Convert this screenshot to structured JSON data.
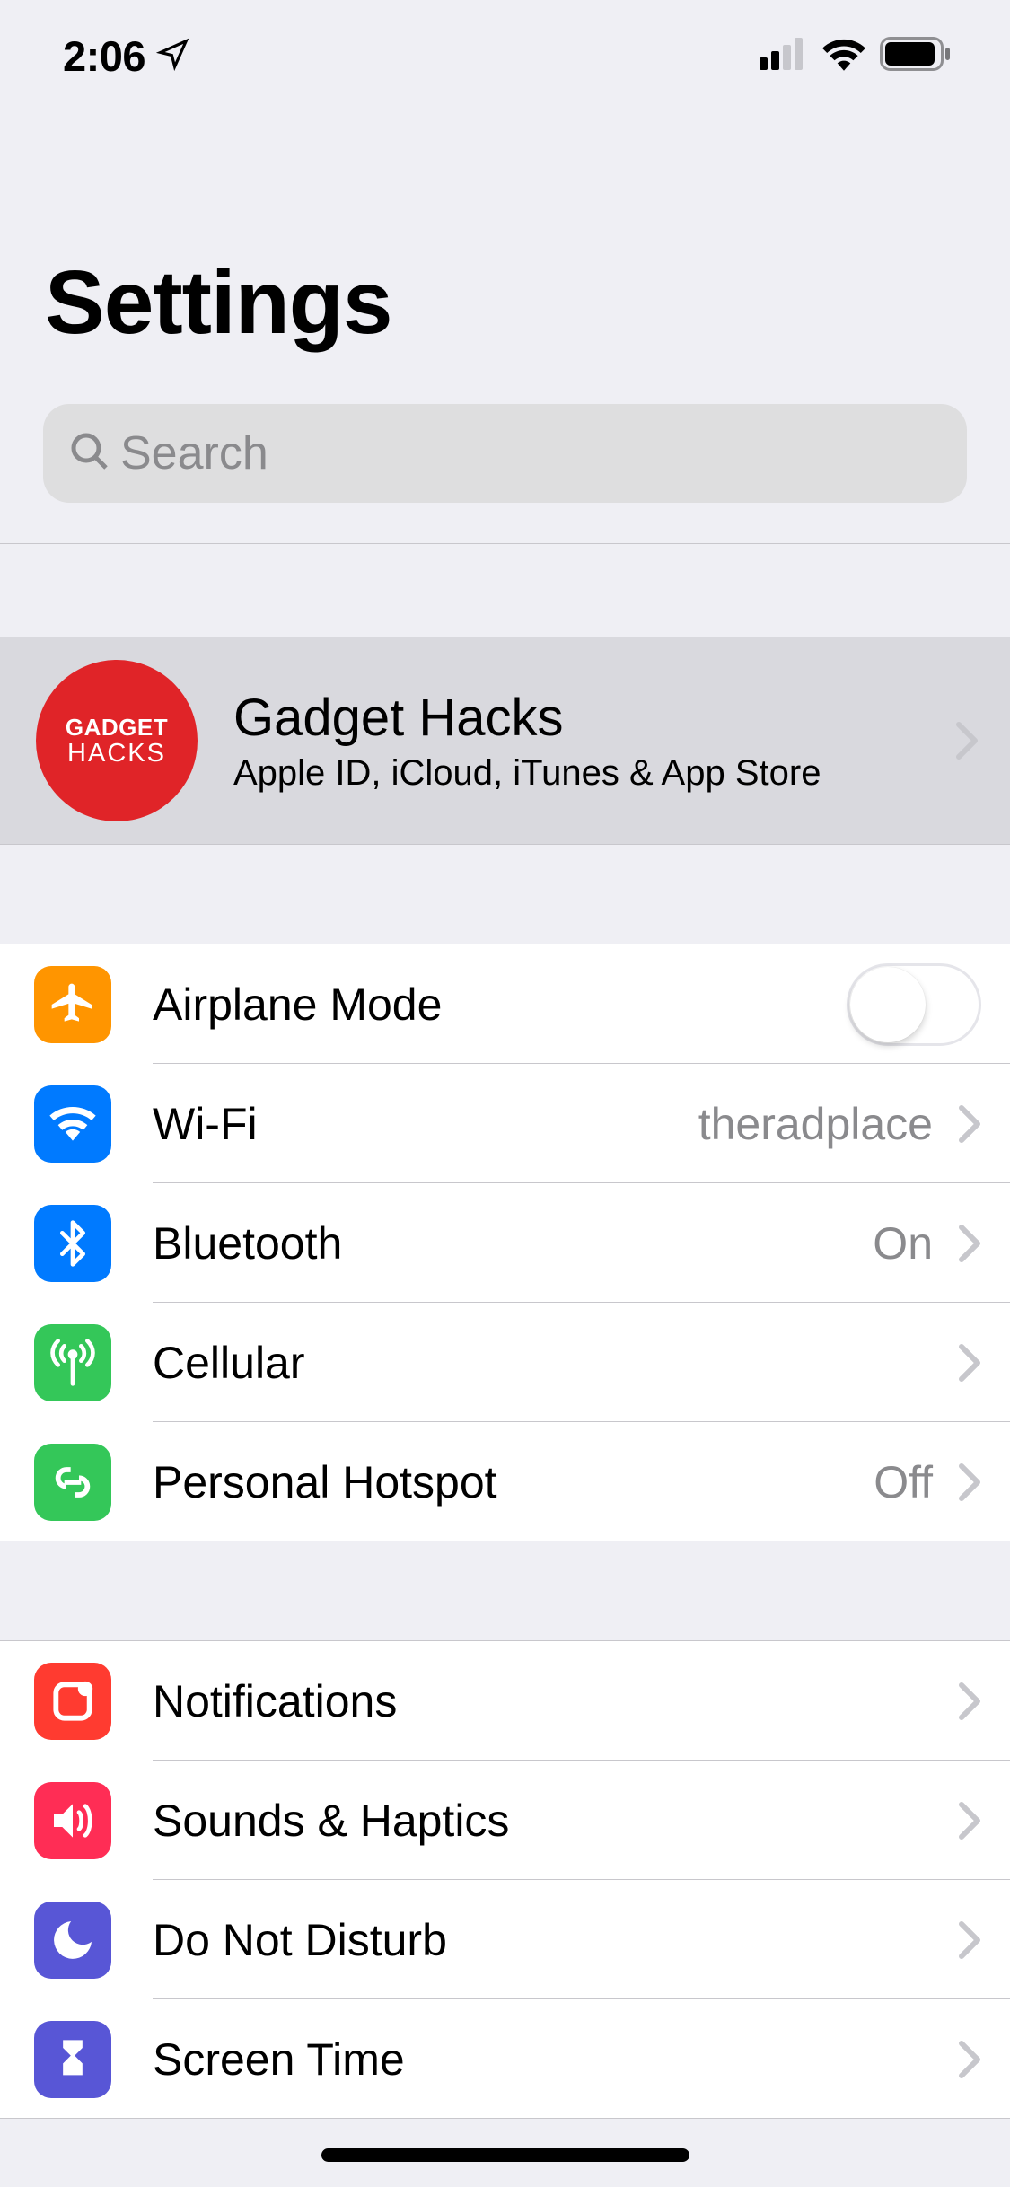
{
  "status": {
    "time": "2:06"
  },
  "header": {
    "title": "Settings"
  },
  "search": {
    "placeholder": "Search"
  },
  "account": {
    "name": "Gadget Hacks",
    "subtitle": "Apple ID, iCloud, iTunes & App Store",
    "avatar_line1": "GADGET",
    "avatar_line2": "HACKS"
  },
  "group1": {
    "airplane": {
      "label": "Airplane Mode",
      "on": false
    },
    "wifi": {
      "label": "Wi-Fi",
      "value": "theradplace"
    },
    "bluetooth": {
      "label": "Bluetooth",
      "value": "On"
    },
    "cellular": {
      "label": "Cellular"
    },
    "hotspot": {
      "label": "Personal Hotspot",
      "value": "Off"
    }
  },
  "group2": {
    "notifications": {
      "label": "Notifications"
    },
    "sounds": {
      "label": "Sounds & Haptics"
    },
    "dnd": {
      "label": "Do Not Disturb"
    },
    "screentime": {
      "label": "Screen Time"
    }
  }
}
